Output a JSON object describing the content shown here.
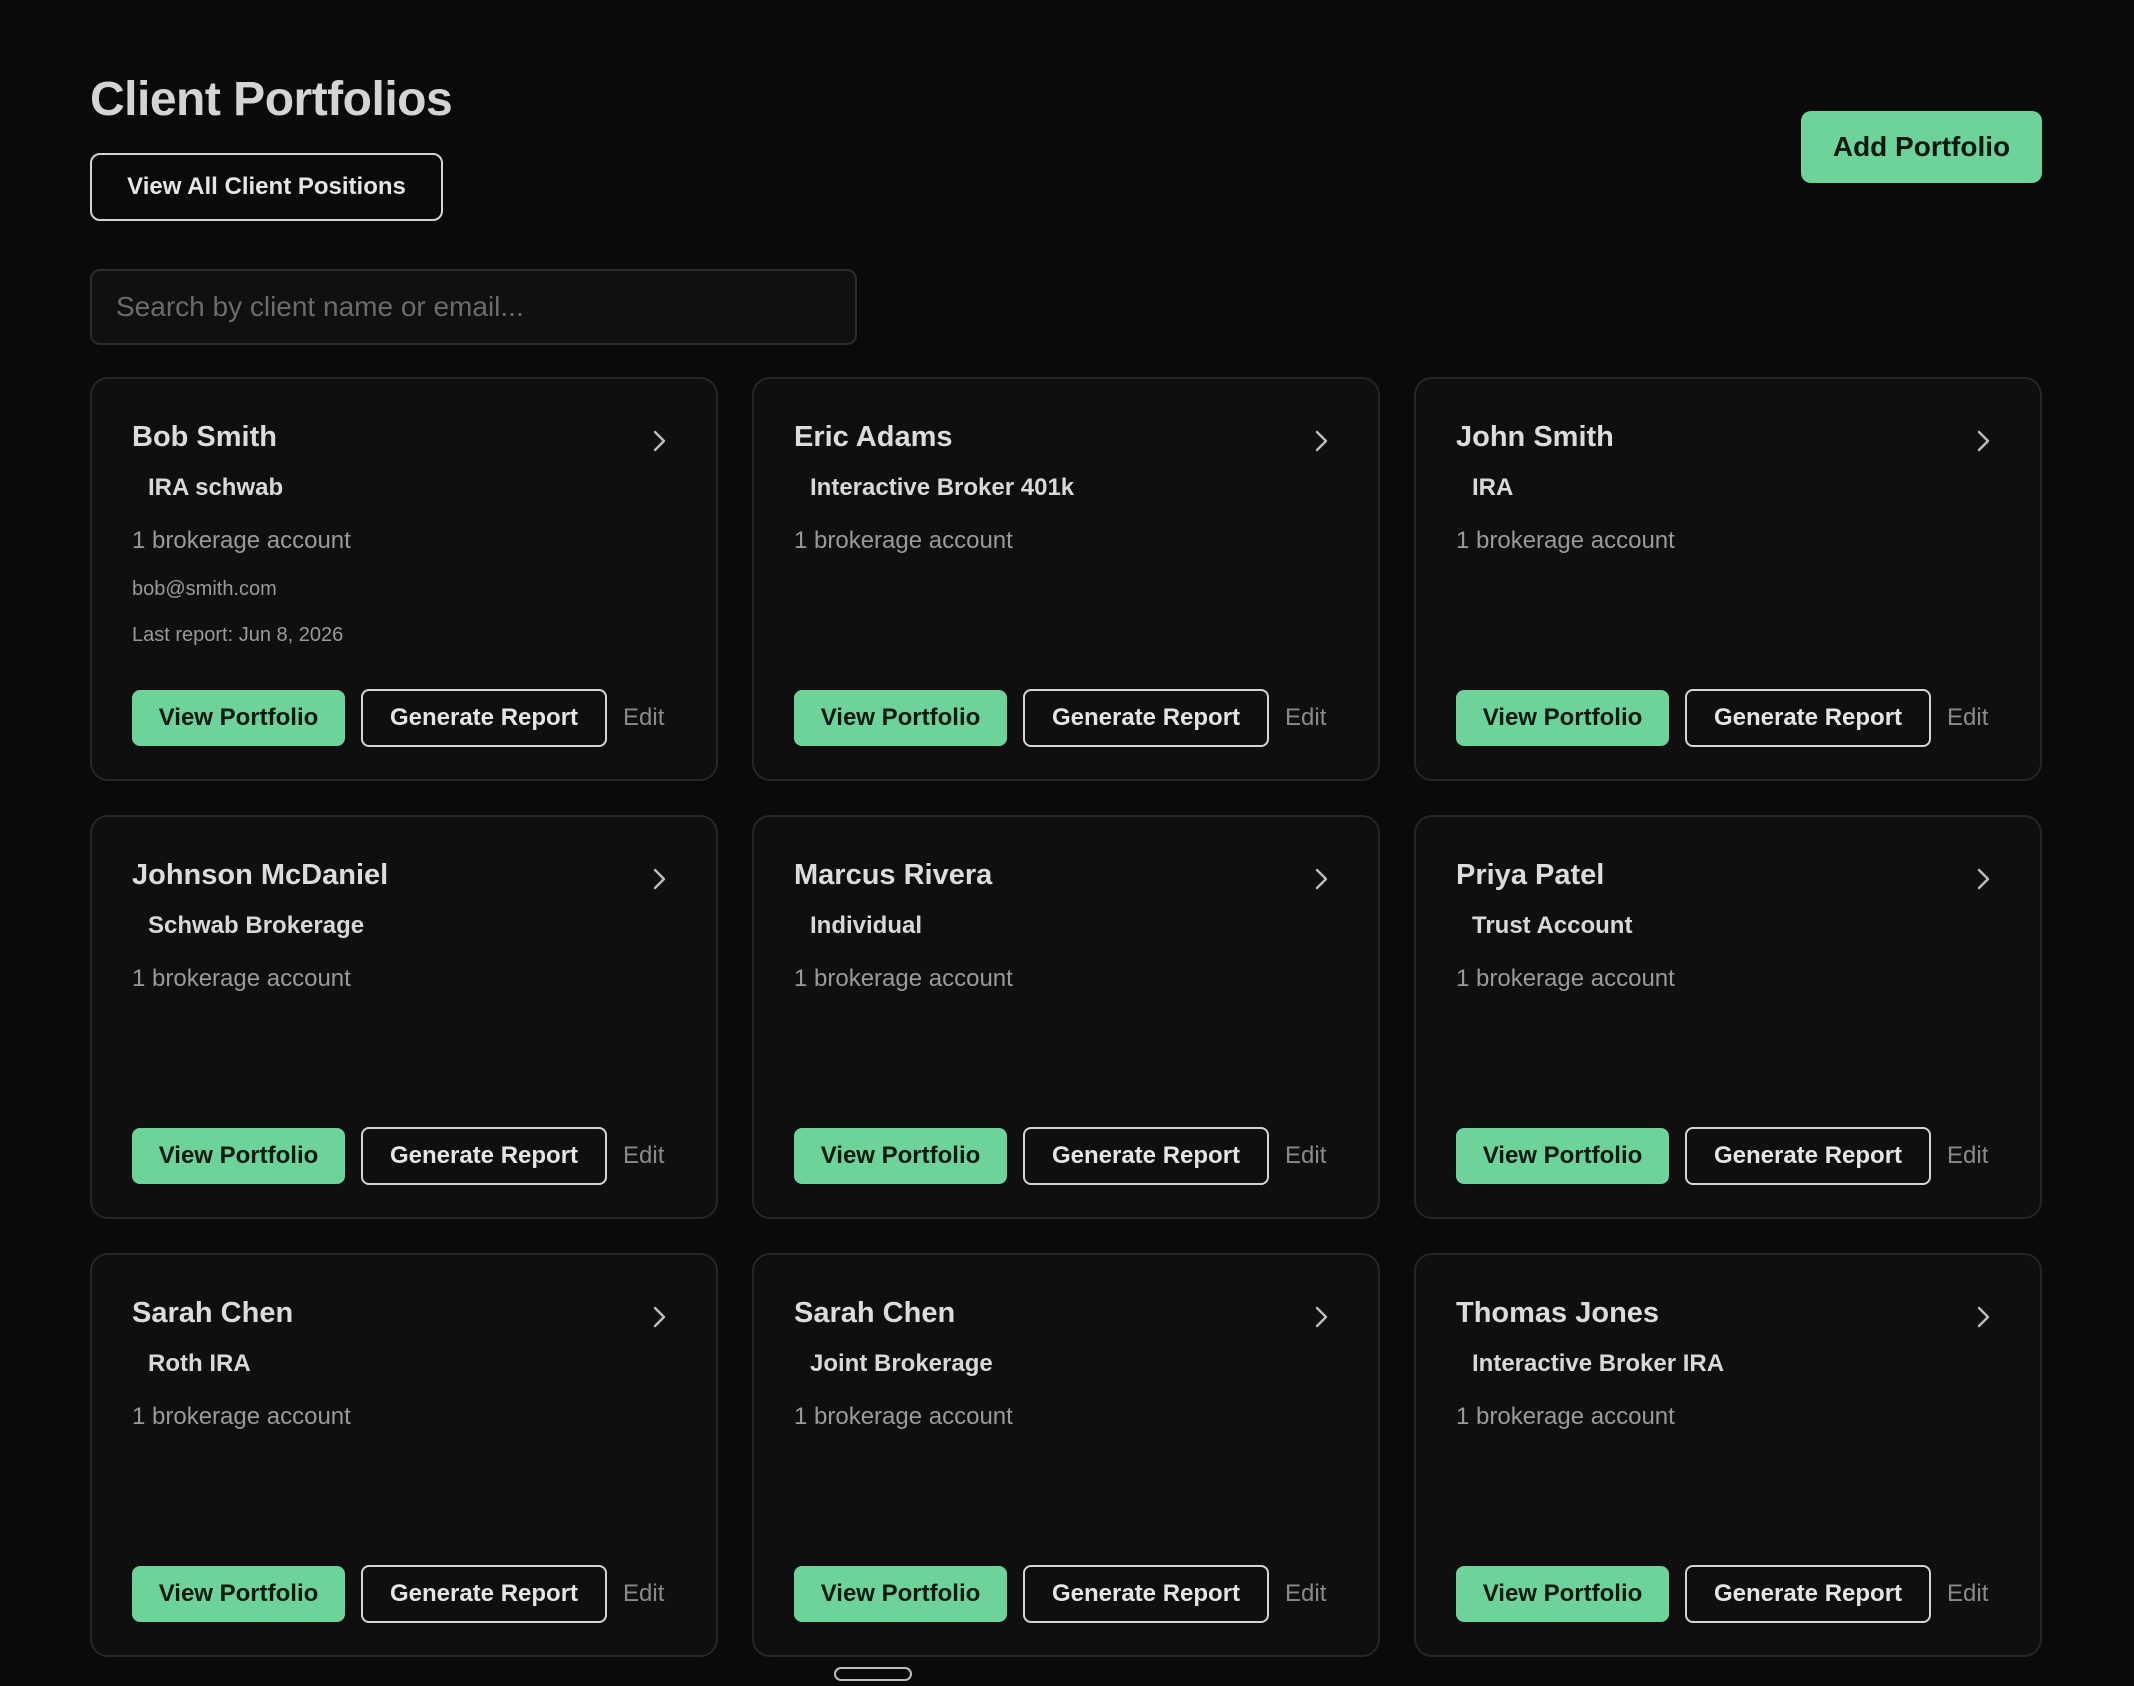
{
  "header": {
    "title": "Client Portfolios",
    "view_all_label": "View All Client Positions",
    "add_label": "Add Portfolio"
  },
  "search": {
    "placeholder": "Search by client name or email...",
    "value": ""
  },
  "card_actions": {
    "view_label": "View Portfolio",
    "generate_label": "Generate Report",
    "edit_label": "Edit"
  },
  "colors": {
    "background": "#0a0a0a",
    "card_background": "#0f0f0f",
    "accent_green": "#6dd39b"
  },
  "cards": [
    {
      "name": "Bob Smith",
      "account": "IRA schwab",
      "count": "1 brokerage account",
      "email": "bob@smith.com",
      "last_report": "Last report: Jun 8, 2026"
    },
    {
      "name": "Eric Adams",
      "account": "Interactive Broker 401k",
      "count": "1 brokerage account",
      "email": "",
      "last_report": ""
    },
    {
      "name": "John Smith",
      "account": "IRA",
      "count": "1 brokerage account",
      "email": "",
      "last_report": ""
    },
    {
      "name": "Johnson McDaniel",
      "account": "Schwab Brokerage",
      "count": "1 brokerage account",
      "email": "",
      "last_report": ""
    },
    {
      "name": "Marcus Rivera",
      "account": "Individual",
      "count": "1 brokerage account",
      "email": "",
      "last_report": ""
    },
    {
      "name": "Priya Patel",
      "account": "Trust Account",
      "count": "1 brokerage account",
      "email": "",
      "last_report": ""
    },
    {
      "name": "Sarah Chen",
      "account": "Roth IRA",
      "count": "1 brokerage account",
      "email": "",
      "last_report": ""
    },
    {
      "name": "Sarah Chen",
      "account": "Joint Brokerage",
      "count": "1 brokerage account",
      "email": "",
      "last_report": ""
    },
    {
      "name": "Thomas Jones",
      "account": "Interactive Broker IRA",
      "count": "1 brokerage account",
      "email": "",
      "last_report": ""
    }
  ]
}
